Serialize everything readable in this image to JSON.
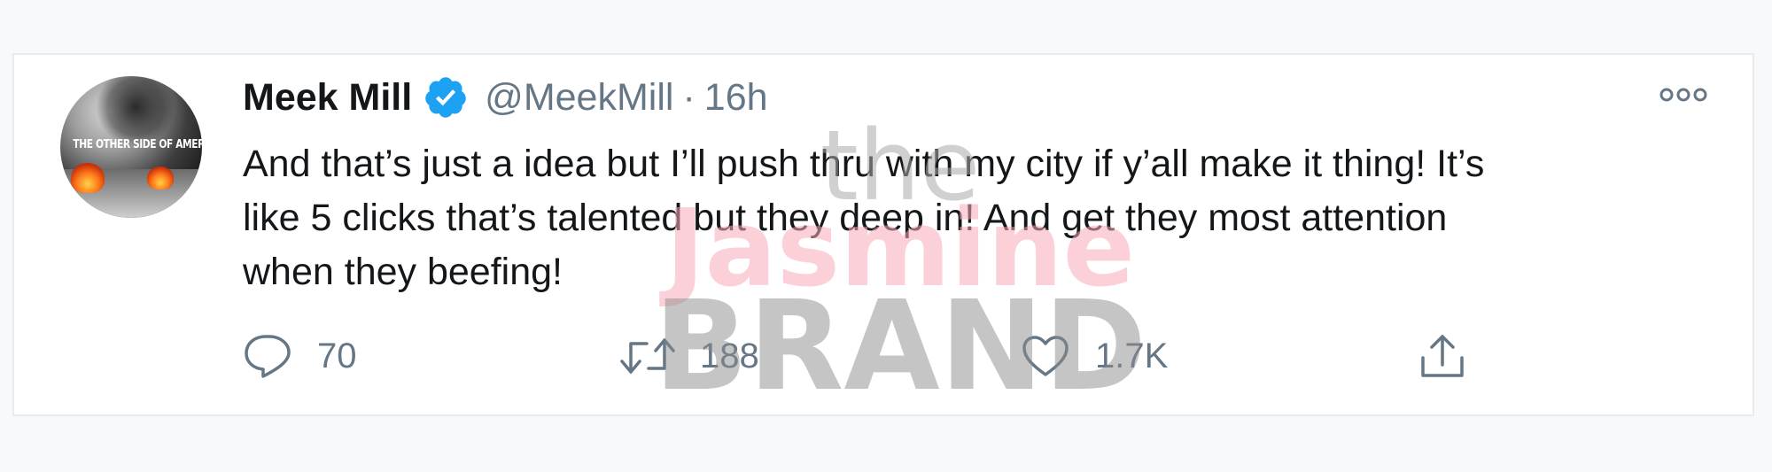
{
  "tweet": {
    "avatar_text": "THE OTHER SIDE OF AMERICA",
    "display_name": "Meek Mill",
    "handle": "@MeekMill",
    "separator": "·",
    "time": "16h",
    "text": "And that’s just a idea but I’ll push thru with my city if y’all make it thing! It’s\nlike 5 clicks that’s talented but they deep in!  And get they most attention\nwhen they beefing!",
    "reply_count": "70",
    "retweet_count": "188",
    "like_count": "1.7K",
    "verified_color": "#1da1f2"
  },
  "icons": {
    "verified": "verified-badge-icon",
    "more": "more-options-icon",
    "reply": "reply-icon",
    "retweet": "retweet-icon",
    "like": "heart-icon",
    "share": "share-icon"
  },
  "watermark": {
    "line1": "the",
    "line2": "Jasmine",
    "line3": "BRAND"
  }
}
